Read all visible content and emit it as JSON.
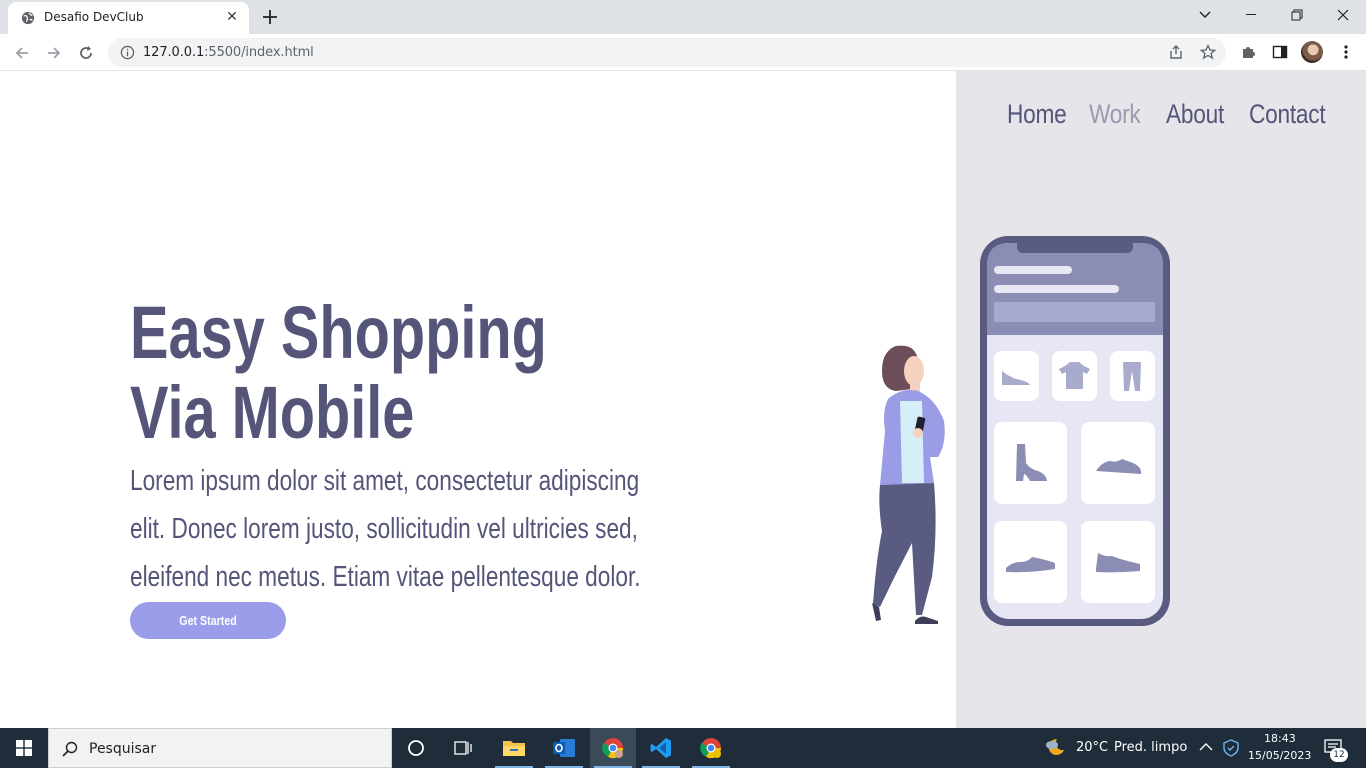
{
  "browser": {
    "tab_title": "Desafio DevClub",
    "tab_close": "✕",
    "url_host": "127.0.0.1",
    "url_rest": ":5500/index.html"
  },
  "nav": {
    "items": [
      {
        "label": "Home"
      },
      {
        "label": "Work"
      },
      {
        "label": "About"
      },
      {
        "label": "Contact"
      }
    ]
  },
  "hero": {
    "title_line1": "Easy Shopping",
    "title_line2": "Via Mobile",
    "text_line1": "Lorem ipsum dolor sit amet, consectetur adipiscing",
    "text_line2": "elit. Donec lorem justo, sollicitudin vel ultricies sed,",
    "text_line3": "eleifend nec metus. Etiam vitae pellentesque dolor.",
    "cta_label": "Get Started"
  },
  "colors": {
    "text_primary": "#545579",
    "nav_dim": "#9a9ab0",
    "panel_bg": "#e6e5ea",
    "cta_bg": "#9b9dea"
  },
  "taskbar": {
    "search_placeholder": "Pesquisar",
    "weather_temp": "20°C",
    "weather_desc": "Pred. limpo",
    "time": "18:43",
    "date": "15/05/2023",
    "notifications": "12"
  }
}
